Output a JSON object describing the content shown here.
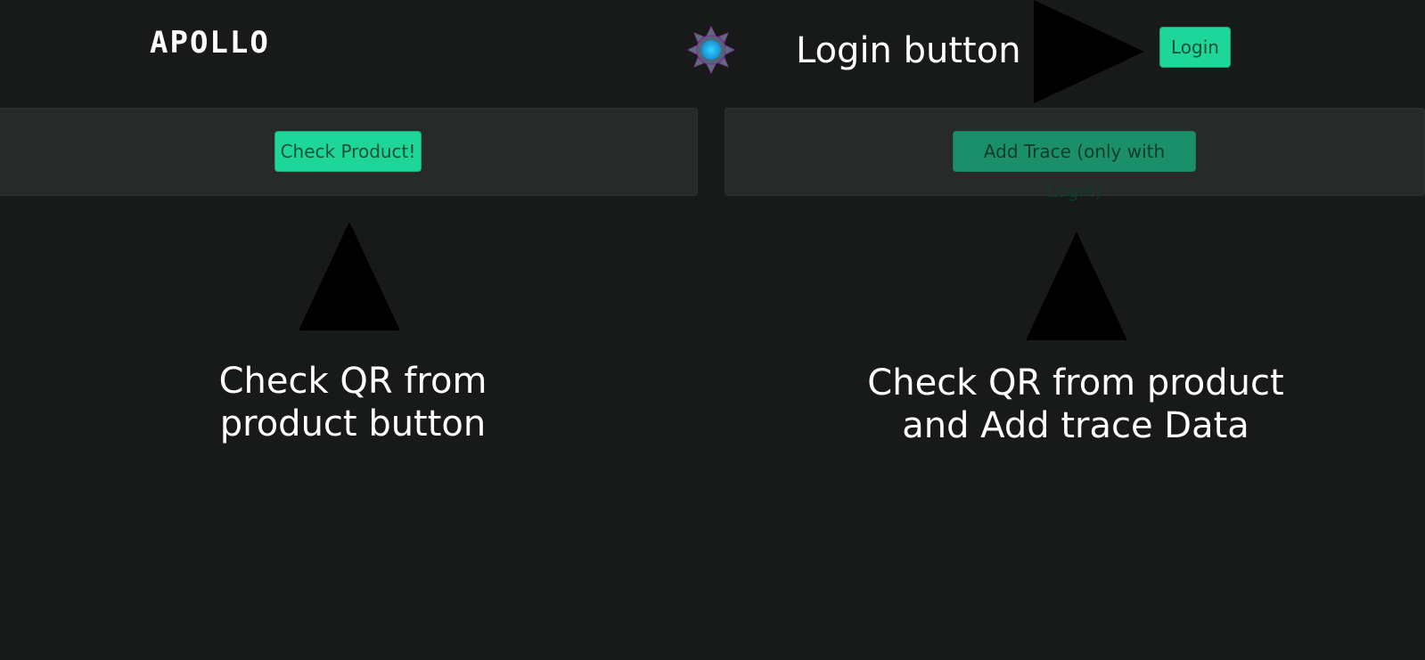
{
  "header": {
    "logo_text": "APOLLO",
    "gear_icon": "gear-icon",
    "login_label": "Login"
  },
  "annotations": {
    "login": "Login button",
    "check_product": "Check QR from product button",
    "add_trace": "Check QR from product and Add trace Data"
  },
  "panels": {
    "left": {
      "button_label": "Check Product!"
    },
    "right": {
      "button_label": "Add Trace (only with Login)"
    }
  },
  "colors": {
    "background": "#171a19",
    "panel": "#272a29",
    "accent": "#1ed69a",
    "accent_disabled": "#1b8f6a",
    "arrow": "#000000",
    "annotation_text": "#ffffff"
  }
}
